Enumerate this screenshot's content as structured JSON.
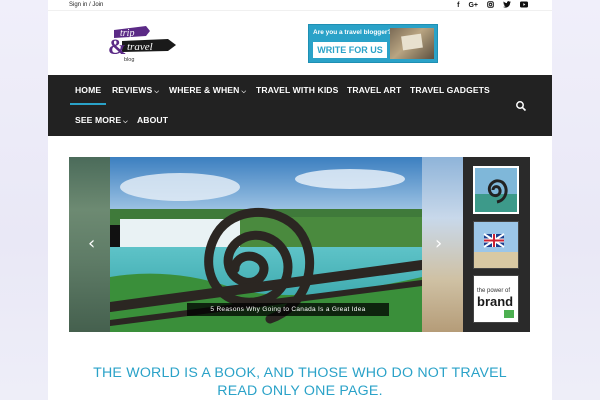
{
  "topbar": {
    "signin_label": "Sign in / Join",
    "socials": [
      "f",
      "G+",
      "instagram",
      "twitter",
      "youtube"
    ]
  },
  "header": {
    "logo": {
      "line1": "trip",
      "line2": "travel",
      "line3": "blog",
      "amp": "&"
    },
    "banner": {
      "tagline": "Are you a travel blogger?",
      "button_label": "WRITE FOR US"
    }
  },
  "nav": {
    "items": [
      {
        "label": "HOME",
        "active": true,
        "dropdown": false
      },
      {
        "label": "REVIEWS",
        "active": false,
        "dropdown": true
      },
      {
        "label": "WHERE & WHEN",
        "active": false,
        "dropdown": true
      },
      {
        "label": "TRAVEL WITH KIDS",
        "active": false,
        "dropdown": false
      },
      {
        "label": "TRAVEL ART",
        "active": false,
        "dropdown": false
      },
      {
        "label": "TRAVEL GADGETS",
        "active": false,
        "dropdown": false
      },
      {
        "label": "SEE MORE",
        "active": false,
        "dropdown": true
      },
      {
        "label": "ABOUT",
        "active": false,
        "dropdown": false
      }
    ],
    "search_icon": "search-icon"
  },
  "slider": {
    "caption": "5 Reasons Why Going to Canada Is a Great Idea",
    "prev_icon": "chevron-left-icon",
    "next_icon": "chevron-right-icon",
    "thumbnails": [
      "thumbnail-spiral",
      "thumbnail-flag",
      "thumbnail-brand"
    ]
  },
  "quote": {
    "line1": "THE WORLD IS A BOOK, AND THOSE WHO DO NOT TRAVEL",
    "line2": "READ ONLY ONE PAGE."
  },
  "colors": {
    "accent": "#2aa2c8",
    "nav_bg": "#222222",
    "logo_purple": "#5b2a86"
  }
}
